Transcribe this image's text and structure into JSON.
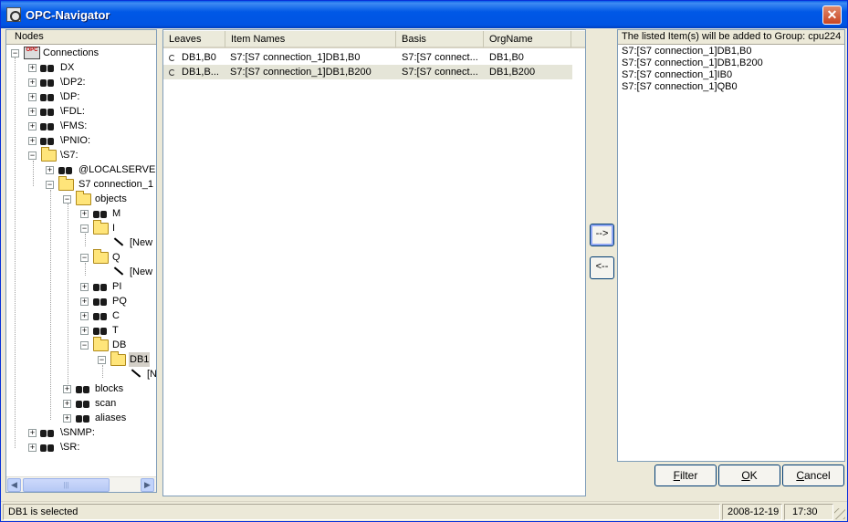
{
  "window": {
    "title": "OPC-Navigator"
  },
  "tree": {
    "header": "Nodes",
    "items": [
      {
        "label": "Connections"
      },
      {
        "label": "DX"
      },
      {
        "label": "\\DP2:"
      },
      {
        "label": "\\DP:"
      },
      {
        "label": "\\FDL:"
      },
      {
        "label": "\\FMS:"
      },
      {
        "label": "\\PNIO:"
      },
      {
        "label": "\\S7:"
      },
      {
        "label": "@LOCALSERVER"
      },
      {
        "label": "S7 connection_1"
      },
      {
        "label": "objects"
      },
      {
        "label": "M"
      },
      {
        "label": "I"
      },
      {
        "label": "[New"
      },
      {
        "label": "Q"
      },
      {
        "label": "[New"
      },
      {
        "label": "PI"
      },
      {
        "label": "PQ"
      },
      {
        "label": "C"
      },
      {
        "label": "T"
      },
      {
        "label": "DB"
      },
      {
        "label": "DB1"
      },
      {
        "label": "[N"
      },
      {
        "label": "blocks"
      },
      {
        "label": "scan"
      },
      {
        "label": "aliases"
      },
      {
        "label": "\\SNMP:"
      },
      {
        "label": "\\SR:"
      }
    ]
  },
  "list": {
    "columns": [
      "Leaves",
      "Item Names",
      "Basis",
      "OrgName"
    ],
    "rows": [
      {
        "leaf": "DB1,B0",
        "item": "S7:[S7 connection_1]DB1,B0",
        "basis": "S7:[S7 connect...",
        "org": "DB1,B0"
      },
      {
        "leaf": "DB1,B...",
        "item": "S7:[S7 connection_1]DB1,B200",
        "basis": "S7:[S7 connect...",
        "org": "DB1,B200"
      }
    ]
  },
  "transfer": {
    "add_label": "-->",
    "remove_label": "<--"
  },
  "right": {
    "header": "The listed Item(s) will be added to Group: cpu224",
    "items": [
      "S7:[S7 connection_1]DB1,B0",
      "S7:[S7 connection_1]DB1,B200",
      "S7:[S7 connection_1]IB0",
      "S7:[S7 connection_1]QB0"
    ]
  },
  "buttons": {
    "filter_ul": "F",
    "filter_rest": "ilter",
    "ok_ul": "O",
    "ok_rest": "K",
    "cancel_ul": "C",
    "cancel_rest": "ancel"
  },
  "status": {
    "message": "DB1 is selected",
    "date": "2008-12-19",
    "time": "17:30"
  }
}
